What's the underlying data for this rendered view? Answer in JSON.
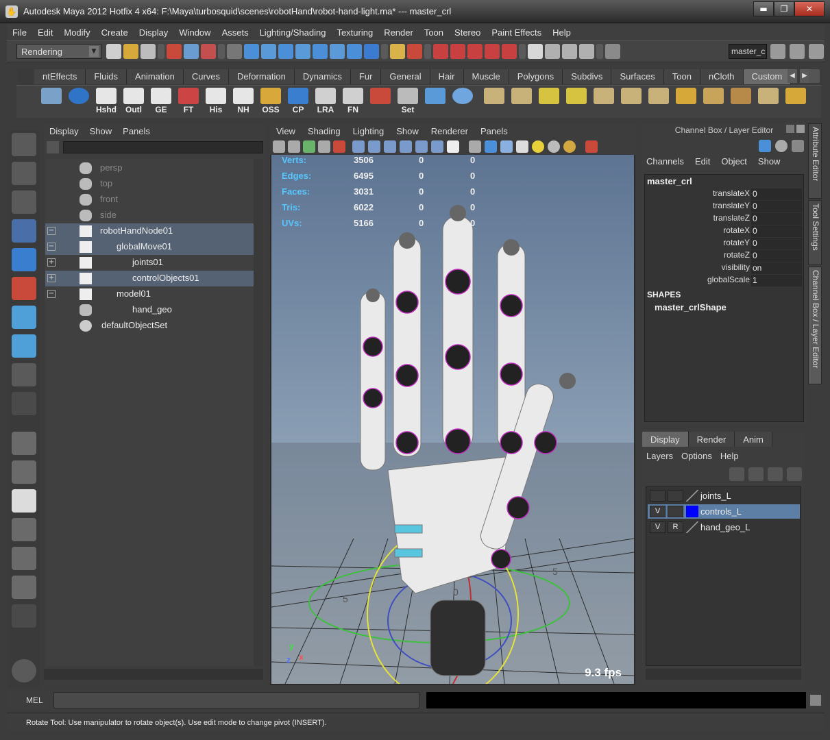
{
  "window": {
    "title": "Autodesk Maya 2012 Hotfix 4 x64: F:\\Maya\\turbosquid\\scenes\\robotHand\\robot-hand-light.ma*   ---   master_crl",
    "app_icon_glyph": "✋",
    "minimize_glyph": "▬",
    "maximize_glyph": "❐",
    "close_glyph": "✕"
  },
  "menus": [
    "File",
    "Edit",
    "Modify",
    "Create",
    "Display",
    "Window",
    "Assets",
    "Lighting/Shading",
    "Texturing",
    "Render",
    "Toon",
    "Stereo",
    "Paint Effects",
    "Help"
  ],
  "status_line": {
    "mode": "Rendering",
    "dropdown_glyph": "▼",
    "object_field": "master_c"
  },
  "shelf": {
    "tabs": [
      "ntEffects",
      "Fluids",
      "Animation",
      "Curves",
      "Deformation",
      "Dynamics",
      "Fur",
      "General",
      "Hair",
      "Muscle",
      "Polygons",
      "Subdivs",
      "Surfaces",
      "Toon",
      "nCloth",
      "Custom"
    ],
    "active_tab": "Custom",
    "buttons": [
      "",
      "",
      "Hshd",
      "Outl",
      "GE",
      "FT",
      "His",
      "NH",
      "OSS",
      "CP",
      "LRA",
      "FN",
      "",
      "Set",
      "",
      ""
    ],
    "left_glyph": "◀",
    "right_glyph": "▶"
  },
  "outliner": {
    "menu": [
      "Display",
      "Show",
      "Panels"
    ],
    "items": [
      {
        "label": "persp",
        "dim": true,
        "expander": ""
      },
      {
        "label": "top",
        "dim": true,
        "expander": ""
      },
      {
        "label": "front",
        "dim": true,
        "expander": ""
      },
      {
        "label": "side",
        "dim": true,
        "expander": ""
      },
      {
        "label": "robotHandNode01",
        "dim": false,
        "expander": "−"
      },
      {
        "label": "globalMove01",
        "dim": false,
        "expander": "−"
      },
      {
        "label": "joints01",
        "dim": false,
        "expander": "+"
      },
      {
        "label": "controlObjects01",
        "dim": false,
        "expander": "+"
      },
      {
        "label": "model01",
        "dim": false,
        "expander": "−"
      },
      {
        "label": "hand_geo",
        "dim": false,
        "expander": ""
      },
      {
        "label": "defaultObjectSet",
        "dim": false,
        "expander": ""
      }
    ]
  },
  "viewport": {
    "menu": [
      "View",
      "Shading",
      "Lighting",
      "Show",
      "Renderer",
      "Panels"
    ],
    "hud": [
      {
        "name": "Verts:",
        "values": [
          "3506",
          "0",
          "0"
        ]
      },
      {
        "name": "Edges:",
        "values": [
          "6495",
          "0",
          "0"
        ]
      },
      {
        "name": "Faces:",
        "values": [
          "3031",
          "0",
          "0"
        ]
      },
      {
        "name": "Tris:",
        "values": [
          "6022",
          "0",
          "0"
        ]
      },
      {
        "name": "UVs:",
        "values": [
          "5166",
          "0",
          "0"
        ]
      }
    ],
    "fps": "9.3 fps",
    "axis_y": "y",
    "axis_z": "z",
    "axis_x": "x",
    "grid_label_5": "5",
    "grid_label_0": "0"
  },
  "channel_box": {
    "header": "Channel Box / Layer Editor",
    "menu": [
      "Channels",
      "Edit",
      "Object",
      "Show"
    ],
    "node": "master_crl",
    "attributes": [
      {
        "name": "translateX",
        "value": "0"
      },
      {
        "name": "translateY",
        "value": "0"
      },
      {
        "name": "translateZ",
        "value": "0"
      },
      {
        "name": "rotateX",
        "value": "0"
      },
      {
        "name": "rotateY",
        "value": "0"
      },
      {
        "name": "rotateZ",
        "value": "0"
      },
      {
        "name": "visibility",
        "value": "on"
      },
      {
        "name": "globalScale",
        "value": "1"
      }
    ],
    "shapes_label": "SHAPES",
    "shape_node": "master_crlShape"
  },
  "side_tabs": [
    "Attribute Editor",
    "Tool Settings",
    "Channel Box / Layer Editor"
  ],
  "layer_editor": {
    "tabs": [
      "Display",
      "Render",
      "Anim"
    ],
    "active_tab": "Display",
    "menu": [
      "Layers",
      "Options",
      "Help"
    ],
    "layers": [
      {
        "v": "",
        "r": "",
        "name": "joints_L",
        "color": "",
        "selected": false
      },
      {
        "v": "V",
        "r": "",
        "name": "controls_L",
        "color": "#0000ff",
        "selected": true
      },
      {
        "v": "V",
        "r": "R",
        "name": "hand_geo_L",
        "color": "",
        "selected": false
      }
    ]
  },
  "command_line": {
    "label": "MEL"
  },
  "help_line": "Rotate Tool: Use manipulator to rotate object(s). Use edit mode to change pivot (INSERT)."
}
